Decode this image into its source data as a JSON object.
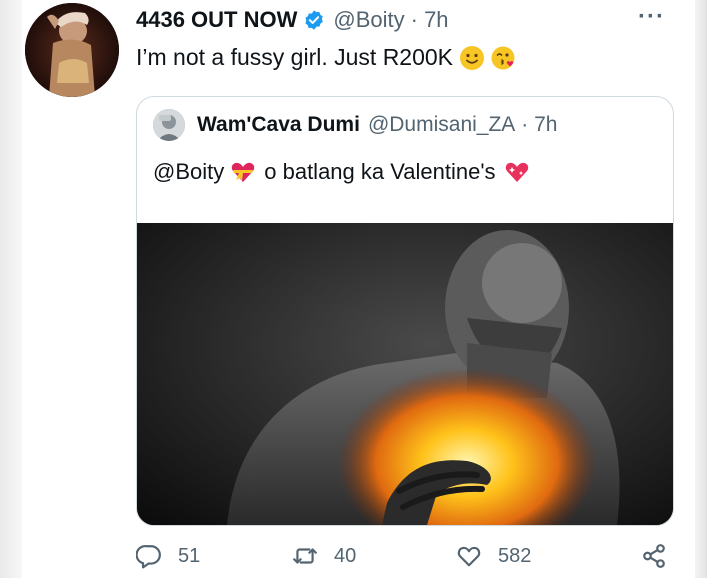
{
  "tweet": {
    "author_name": "4436 OUT NOW",
    "handle": "@Boity",
    "time": "· 7h",
    "text": "I’m not a fussy girl. Just R200K",
    "more_label": "···"
  },
  "quoted": {
    "author_name": "Wam'Cava Dumi",
    "handle": "@Dumisani_ZA",
    "time": "· 7h",
    "mention": "@Boity",
    "text": "o batlang ka Valentine's"
  },
  "actions": {
    "replies": "51",
    "retweets": "40",
    "likes": "582"
  },
  "colors": {
    "verified": "#1d9bf0",
    "secondary_text": "#536471",
    "border": "#cfd9de"
  },
  "icons": [
    "verified-badge-icon",
    "smile-emoji-icon",
    "kissing-face-emoji-icon",
    "more-icon",
    "reply-icon",
    "retweet-icon",
    "like-icon",
    "share-icon",
    "heart-ribbon-emoji-icon",
    "sparkling-heart-emoji-icon"
  ]
}
